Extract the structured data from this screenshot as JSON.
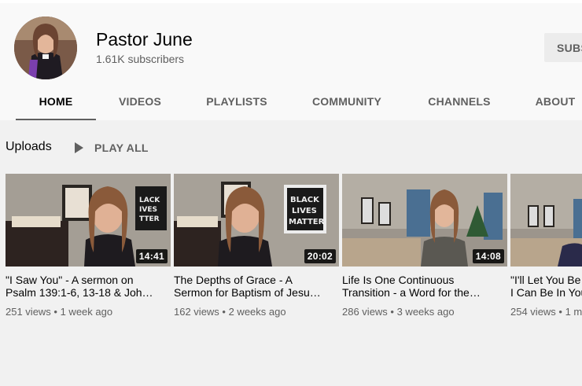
{
  "channel": {
    "name": "Pastor June",
    "subscribers": "1.61K subscribers",
    "subscribe_label": "SUBS"
  },
  "tabs": [
    {
      "label": "HOME",
      "active": true
    },
    {
      "label": "VIDEOS",
      "active": false
    },
    {
      "label": "PLAYLISTS",
      "active": false
    },
    {
      "label": "COMMUNITY",
      "active": false
    },
    {
      "label": "CHANNELS",
      "active": false
    },
    {
      "label": "ABOUT",
      "active": false
    }
  ],
  "uploads": {
    "title": "Uploads",
    "play_all_label": "PLAY ALL"
  },
  "videos": [
    {
      "title_line1": "\"I Saw You\" - A sermon on",
      "title_line2": "Psalm 139:1-6, 13-18 & Joh…",
      "duration": "14:41",
      "meta": "251 views • 1 week ago"
    },
    {
      "title_line1": "The Depths of Grace - A",
      "title_line2": "Sermon for Baptism of Jesu…",
      "duration": "20:02",
      "meta": "162 views • 2 weeks ago"
    },
    {
      "title_line1": "Life Is One Continuous",
      "title_line2": "Transition - a Word for the…",
      "duration": "14:08",
      "meta": "286 views • 3 weeks ago"
    },
    {
      "title_line1": "\"I'll Let You Be",
      "title_line2": "I Can Be In You",
      "duration": "",
      "meta": "254 views • 1 m"
    }
  ],
  "colors": {
    "header_bg": "#f9f9f9",
    "page_bg": "#f1f1f1",
    "tab_text": "#606060",
    "active_tab_text": "#030303"
  }
}
